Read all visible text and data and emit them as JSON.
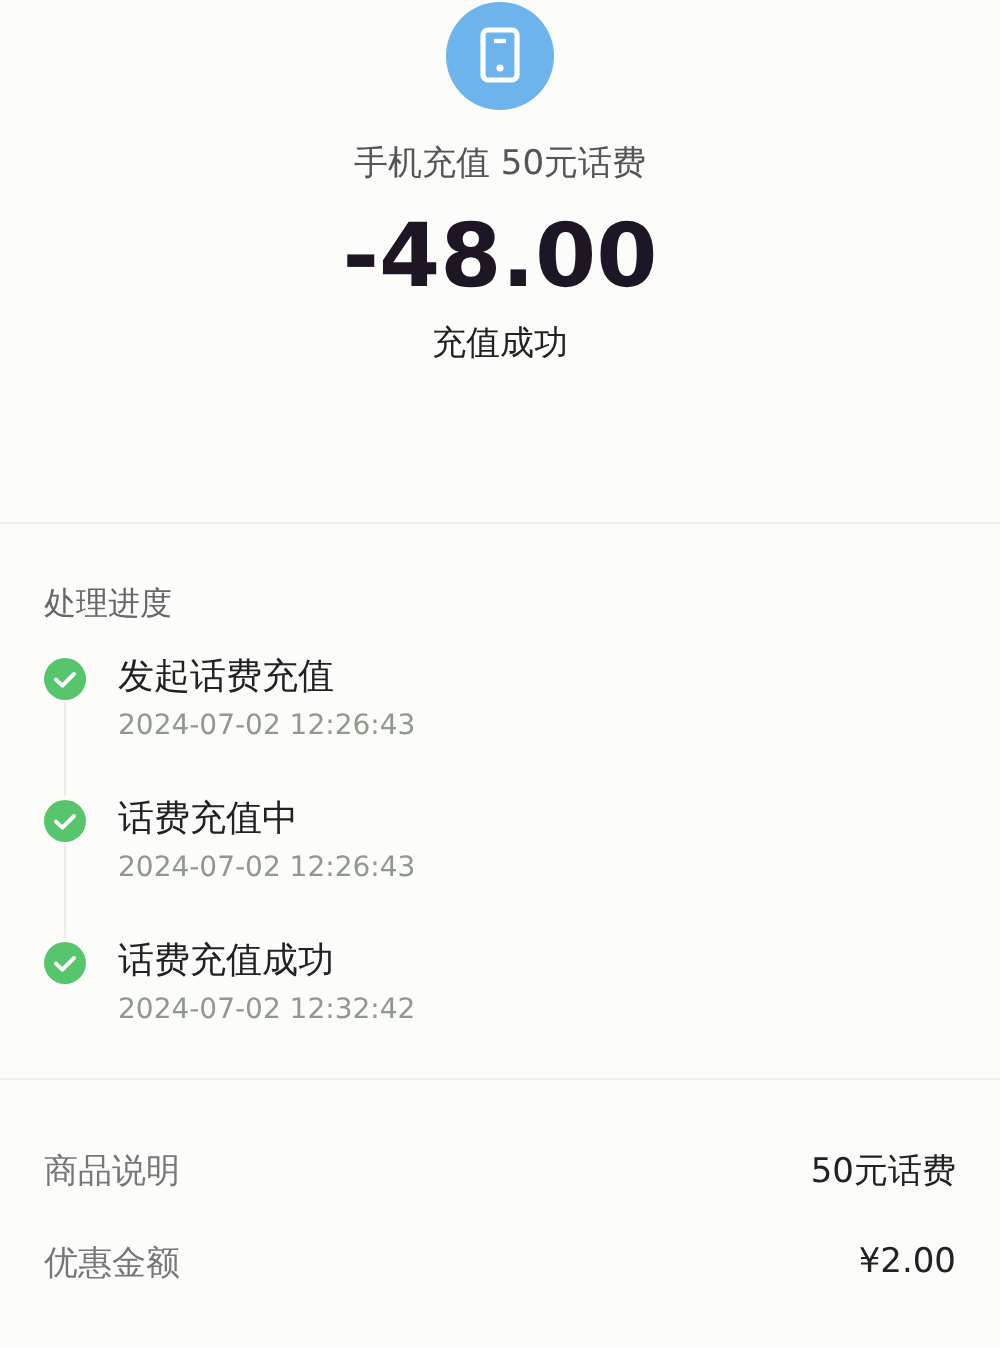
{
  "header": {
    "title": "手机充值 50元话费",
    "amount": "-48.00",
    "status": "充值成功"
  },
  "progress": {
    "title": "处理进度",
    "steps": [
      {
        "label": "发起话费充值",
        "time": "2024-07-02 12:26:43",
        "done": true
      },
      {
        "label": "话费充值中",
        "time": "2024-07-02 12:26:43",
        "done": true
      },
      {
        "label": "话费充值成功",
        "time": "2024-07-02 12:32:42",
        "done": true
      }
    ]
  },
  "details": [
    {
      "label": "商品说明",
      "value": "50元话费"
    },
    {
      "label": "优惠金额",
      "value": "¥2.00"
    }
  ]
}
